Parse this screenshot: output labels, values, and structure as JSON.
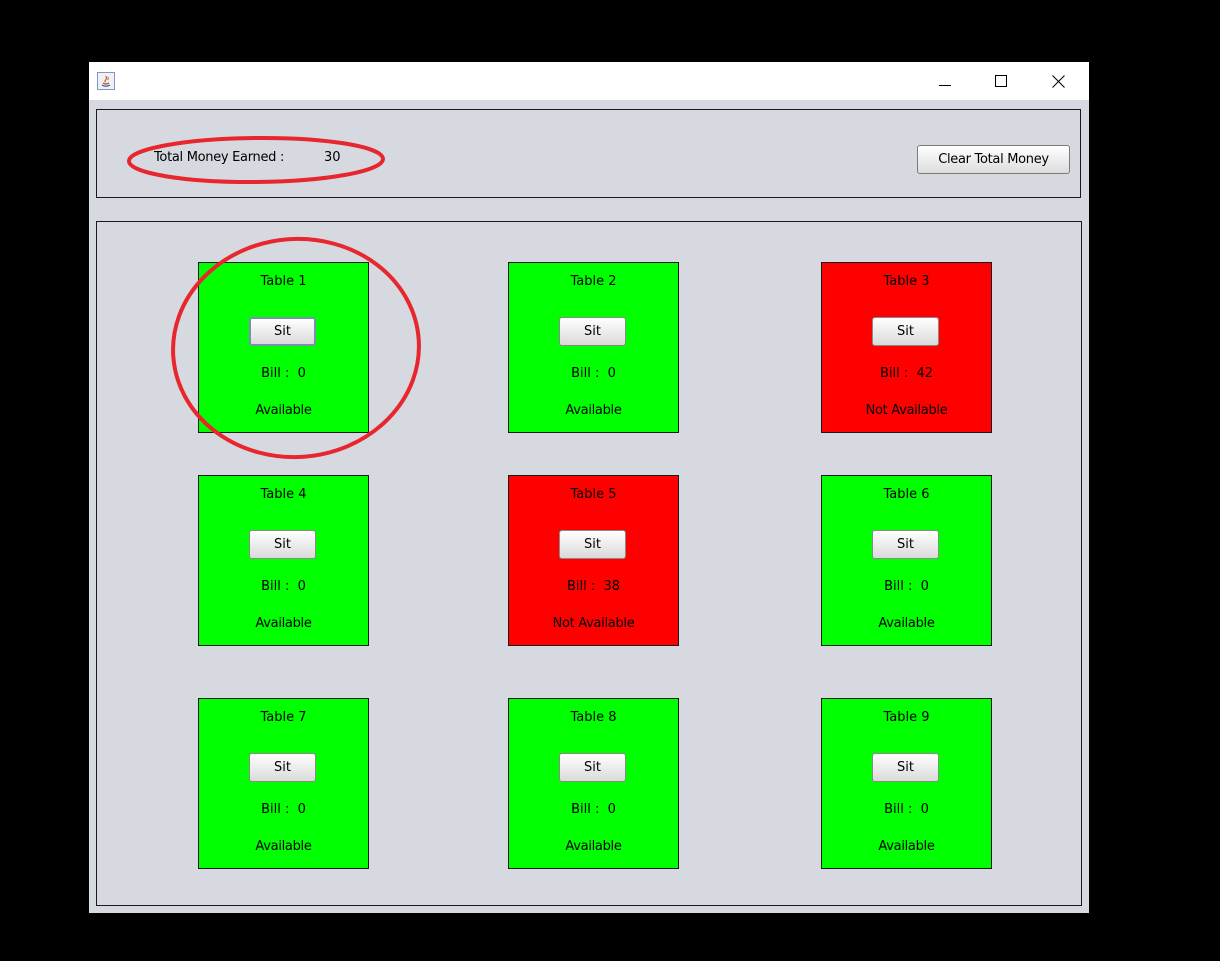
{
  "header": {
    "money_label": "Total Money Earned :",
    "money_value": "30",
    "clear_button_label": "Clear Total Money"
  },
  "tables": [
    {
      "name": "Table 1",
      "sit_label": "Sit",
      "bill": "Bill :  0",
      "status": "Available",
      "color": "#00ff00"
    },
    {
      "name": "Table 2",
      "sit_label": "Sit",
      "bill": "Bill :  0",
      "status": "Available",
      "color": "#00ff00"
    },
    {
      "name": "Table 3",
      "sit_label": "Sit",
      "bill": "Bill :  42",
      "status": "Not Available",
      "color": "#ff0000"
    },
    {
      "name": "Table 4",
      "sit_label": "Sit",
      "bill": "Bill :  0",
      "status": "Available",
      "color": "#00ff00"
    },
    {
      "name": "Table 5",
      "sit_label": "Sit",
      "bill": "Bill :  38",
      "status": "Not Available",
      "color": "#ff0000"
    },
    {
      "name": "Table 6",
      "sit_label": "Sit",
      "bill": "Bill :  0",
      "status": "Available",
      "color": "#00ff00"
    },
    {
      "name": "Table 7",
      "sit_label": "Sit",
      "bill": "Bill :  0",
      "status": "Available",
      "color": "#00ff00"
    },
    {
      "name": "Table 8",
      "sit_label": "Sit",
      "bill": "Bill :  0",
      "status": "Available",
      "color": "#00ff00"
    },
    {
      "name": "Table 9",
      "sit_label": "Sit",
      "bill": "Bill :  0",
      "status": "Available",
      "color": "#00ff00"
    }
  ],
  "colors": {
    "available": "#00ff00",
    "not_available": "#ff0000",
    "annotation": "#e8262d"
  },
  "icons": {
    "app": "java-app-icon",
    "minimize": "minimize-icon",
    "maximize": "maximize-icon",
    "close": "close-icon"
  }
}
